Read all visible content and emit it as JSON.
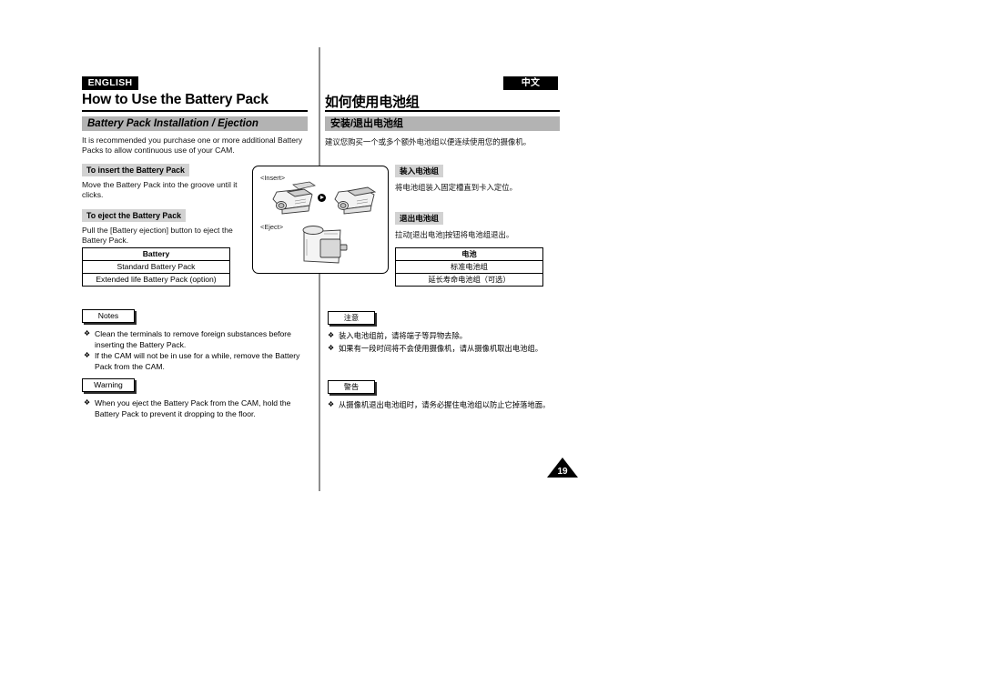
{
  "page": {
    "number": "19",
    "language_badges": {
      "english": "ENGLISH",
      "chinese": "中文"
    }
  },
  "english": {
    "chapter_title": "How to Use the Battery Pack",
    "section_title": "Battery Pack Installation / Ejection",
    "intro": "It is recommended you purchase one or more additional Battery Packs to allow continuous use of your CAM.",
    "insert_heading": "To insert the Battery Pack",
    "insert_text": "Move the Battery Pack into the groove until it clicks.",
    "eject_heading": "To eject the Battery Pack",
    "eject_text": "Pull the [Battery ejection] button to eject the Battery Pack.",
    "table": {
      "header": "Battery",
      "rows": [
        "Standard Battery Pack",
        "Extended life Battery Pack (option)"
      ]
    },
    "notes_label": "Notes",
    "notes": [
      "Clean the terminals to remove foreign substances before inserting the Battery Pack.",
      "If the CAM will not be in use for a while, remove the Battery Pack from the CAM."
    ],
    "warning_label": "Warning",
    "warnings": [
      "When you eject the Battery Pack from the CAM, hold the Battery Pack to prevent it dropping to the floor."
    ]
  },
  "chinese": {
    "chapter_title": "如何使用电池组",
    "section_title": "安装/退出电池组",
    "intro": "建议您购买一个或多个额外电池组以便连续使用您的摄像机。",
    "insert_heading": "装入电池组",
    "insert_text": "将电池组装入固定槽直到卡入定位。",
    "eject_heading": "退出电池组",
    "eject_text": "拉动[退出电池]按钮将电池组退出。",
    "table": {
      "header": "电池",
      "rows": [
        "标准电池组",
        "延长寿命电池组（可选）"
      ]
    },
    "notes_label": "注意",
    "notes": [
      "装入电池组前，请将端子等异物去除。",
      "如果有一段时间将不会使用摄像机，请从摄像机取出电池组。"
    ],
    "warning_label": "警告",
    "warnings": [
      "从摄像机退出电池组时，请务必握住电池组以防止它掉落地面。"
    ]
  },
  "illustration": {
    "insert_label": "<Insert>",
    "eject_label": "<Eject>"
  },
  "colors": {
    "section_bar": "#b3b3b3",
    "subhead_chip": "#d2d2d2",
    "badge": "#000000"
  }
}
